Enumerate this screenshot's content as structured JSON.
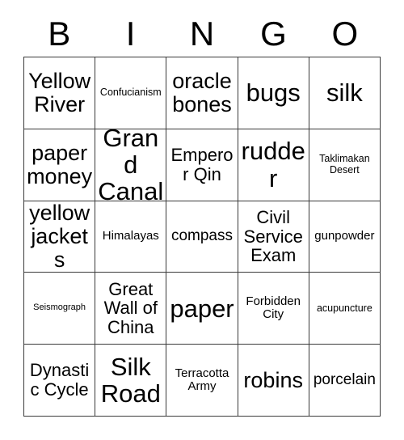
{
  "card": {
    "title": "Bingo Card",
    "header_letters": [
      "B",
      "I",
      "N",
      "G",
      "O"
    ],
    "grid_size": "5x5",
    "colors": {
      "background": "#ffffff",
      "text": "#000000",
      "border": "#3a3a3a"
    },
    "rows": [
      [
        {
          "label": "Yellow River",
          "size": "sz-lg"
        },
        {
          "label": "Confucianism",
          "size": "sz-xxs"
        },
        {
          "label": "oracle bones",
          "size": "sz-lg"
        },
        {
          "label": "bugs",
          "size": "sz-xl"
        },
        {
          "label": "silk",
          "size": "sz-xl"
        }
      ],
      [
        {
          "label": "paper money",
          "size": "sz-lg"
        },
        {
          "label": "Grand Canal",
          "size": "sz-xl"
        },
        {
          "label": "Emperor Qin",
          "size": "sz-md"
        },
        {
          "label": "rudder",
          "size": "sz-xl"
        },
        {
          "label": "Taklimakan Desert",
          "size": "sz-xxs"
        }
      ],
      [
        {
          "label": "yellow jackets",
          "size": "sz-lg"
        },
        {
          "label": "Himalayas",
          "size": "sz-xs"
        },
        {
          "label": "compass",
          "size": "sz-sm"
        },
        {
          "label": "Civil Service Exam",
          "size": "sz-md"
        },
        {
          "label": "gunpowder",
          "size": "sz-xs"
        }
      ],
      [
        {
          "label": "Seismograph",
          "size": "sz-tiny"
        },
        {
          "label": "Great Wall of China",
          "size": "sz-md"
        },
        {
          "label": "paper",
          "size": "sz-xl"
        },
        {
          "label": "Forbidden City",
          "size": "sz-xs"
        },
        {
          "label": "acupuncture",
          "size": "sz-xxs"
        }
      ],
      [
        {
          "label": "Dynastic Cycle",
          "size": "sz-md"
        },
        {
          "label": "Silk Road",
          "size": "sz-xl"
        },
        {
          "label": "Terracotta Army",
          "size": "sz-xs"
        },
        {
          "label": "robins",
          "size": "sz-lg"
        },
        {
          "label": "porcelain",
          "size": "sz-sm"
        }
      ]
    ]
  }
}
